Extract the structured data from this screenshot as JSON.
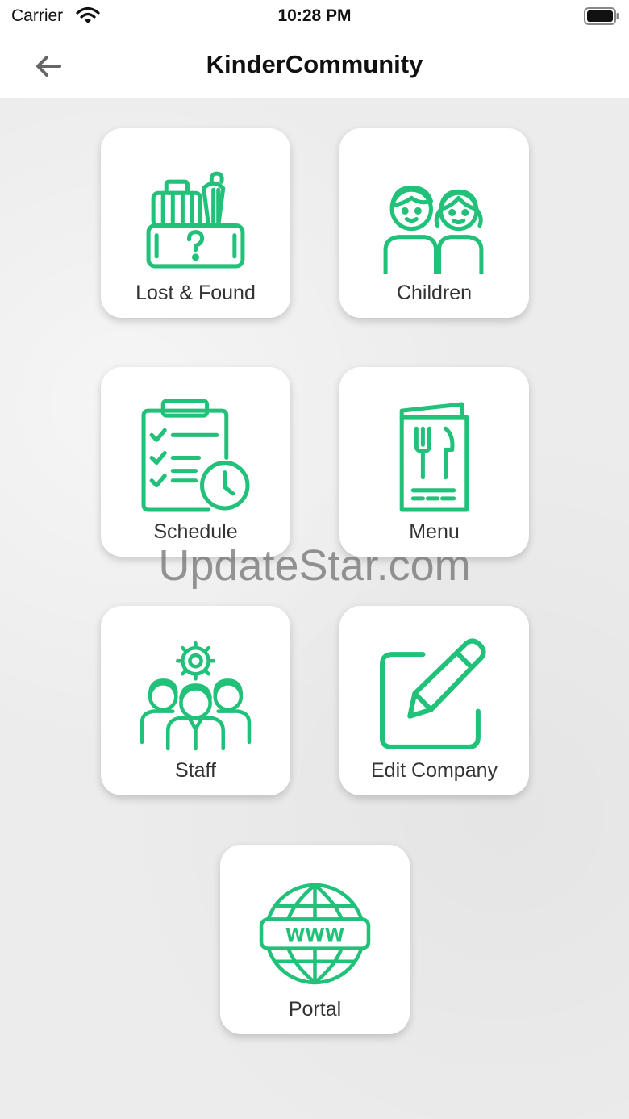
{
  "status_bar": {
    "carrier": "Carrier",
    "time": "10:28 PM"
  },
  "nav": {
    "title": "KinderCommunity",
    "back_icon": "arrow-left-icon"
  },
  "tiles": [
    {
      "label": "Lost & Found",
      "icon": "lost-and-found-icon"
    },
    {
      "label": "Children",
      "icon": "children-icon"
    },
    {
      "label": "Schedule",
      "icon": "schedule-clipboard-icon"
    },
    {
      "label": "Menu",
      "icon": "menu-cutlery-icon"
    },
    {
      "label": "Staff",
      "icon": "staff-group-icon"
    },
    {
      "label": "Edit Company",
      "icon": "edit-pencil-icon"
    },
    {
      "label": "Portal",
      "icon": "globe-www-icon"
    }
  ],
  "watermark": "UpdateStar.com",
  "colors": {
    "accent": "#22c17a",
    "background": "#ececec",
    "card": "#ffffff"
  }
}
